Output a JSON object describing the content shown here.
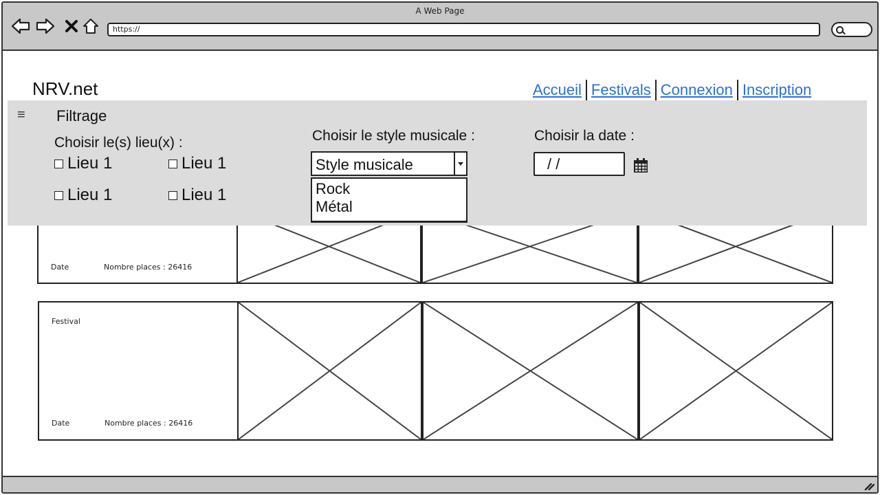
{
  "window": {
    "title": "A Web Page",
    "url": "https://"
  },
  "site": {
    "logo": "NRV.net",
    "nav": [
      "Accueil",
      "Festivals",
      "Connexion",
      "Inscription"
    ],
    "link_color": "#2a6fdb"
  },
  "filter": {
    "menu_icon": "≡",
    "title": "Filtrage",
    "lieux_label": "Choisir le(s) lieu(x) :",
    "lieux": [
      "Lieu 1",
      "Lieu 1",
      "Lieu 1",
      "Lieu 1"
    ],
    "style_label": "Choisir le style musicale :",
    "style_select": "Style musicale",
    "style_options": [
      "Rock",
      "Métal"
    ],
    "date_label": "Choisir la date :",
    "date_value": "/  /",
    "panel_color": "#dcdcdc"
  },
  "cards": [
    {
      "title": "",
      "date": "Date",
      "places": "Nombre places : 26416"
    },
    {
      "title": "Festival",
      "date": "Date",
      "places": "Nombre places : 26416"
    }
  ]
}
